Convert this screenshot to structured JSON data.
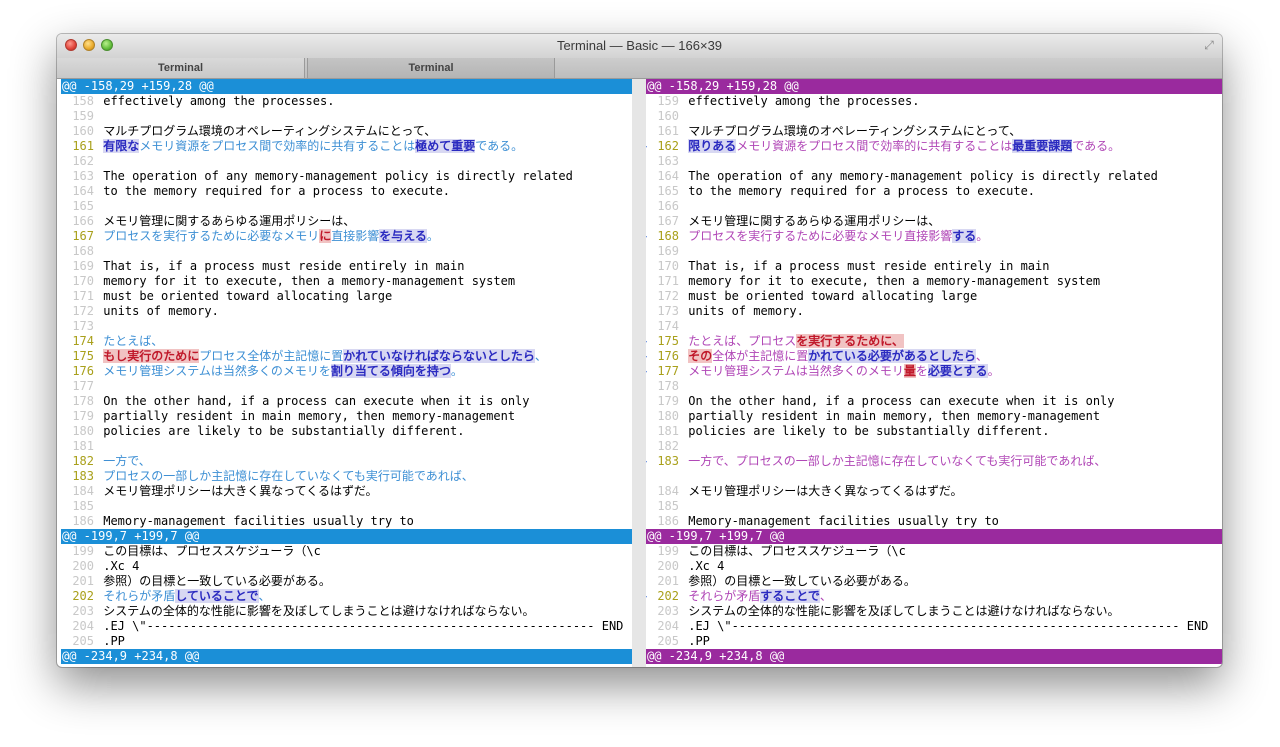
{
  "window": {
    "title": "Terminal — Basic — 166×39",
    "tabs": [
      "Terminal",
      "Terminal"
    ]
  },
  "colors": {
    "left_header": "#1b8fd7",
    "right_header": "#9a2a9e",
    "left_changed": "#3d8fd4",
    "right_changed": "#b046b6"
  },
  "icons": {
    "fullscreen": "⤢",
    "diff_marker": "<>",
    "left_only_marker": "<"
  },
  "left": [
    {
      "t": "h",
      "s": [
        [
          "@@ -158,29 +159,28 @@"
        ]
      ]
    },
    {
      "n": "158",
      "s": [
        [
          "effectively among the processes."
        ]
      ]
    },
    {
      "n": "159",
      "s": []
    },
    {
      "n": "160",
      "s": [
        [
          "マルチプログラム環境のオペレーティングシステムにとって、"
        ]
      ]
    },
    {
      "n": "161",
      "c": true,
      "s": [
        [
          "有限な",
          "h"
        ],
        [
          "メモリ資源をプロセス間で効率的に共有することは"
        ],
        [
          "極めて重要",
          "h"
        ],
        [
          "である。"
        ]
      ]
    },
    {
      "n": "162",
      "s": []
    },
    {
      "n": "163",
      "s": [
        [
          "The operation of any memory-management policy is directly related"
        ]
      ]
    },
    {
      "n": "164",
      "s": [
        [
          "to the memory required for a process to execute."
        ]
      ]
    },
    {
      "n": "165",
      "s": []
    },
    {
      "n": "166",
      "s": [
        [
          "メモリ管理に関するあらゆる運用ポリシーは、"
        ]
      ]
    },
    {
      "n": "167",
      "c": true,
      "s": [
        [
          "プロセスを実行するために必要なメモリ"
        ],
        [
          "に",
          "r"
        ],
        [
          "直接影響"
        ],
        [
          "を与える",
          "h"
        ],
        [
          "。"
        ]
      ]
    },
    {
      "n": "168",
      "s": []
    },
    {
      "n": "169",
      "s": [
        [
          "That is, if a process must reside entirely in main"
        ]
      ]
    },
    {
      "n": "170",
      "s": [
        [
          "memory for it to execute, then a memory-management system"
        ]
      ]
    },
    {
      "n": "171",
      "s": [
        [
          "must be oriented toward allocating large"
        ]
      ]
    },
    {
      "n": "172",
      "s": [
        [
          "units of memory."
        ]
      ]
    },
    {
      "n": "173",
      "s": []
    },
    {
      "n": "174",
      "c": true,
      "s": [
        [
          "たとえば、"
        ]
      ]
    },
    {
      "n": "175",
      "c": true,
      "s": [
        [
          "もし実行のために",
          "r"
        ],
        [
          "プロセス全体が主記憶に置"
        ],
        [
          "かれていなければならないとしたら",
          "h"
        ],
        [
          "、"
        ]
      ]
    },
    {
      "n": "176",
      "c": true,
      "s": [
        [
          "メモリ管理システムは当然多くのメモリを"
        ],
        [
          "割り当てる傾向を持つ",
          "h"
        ],
        [
          "。"
        ]
      ]
    },
    {
      "n": "177",
      "s": []
    },
    {
      "n": "178",
      "s": [
        [
          "On the other hand, if a process can execute when it is only"
        ]
      ]
    },
    {
      "n": "179",
      "s": [
        [
          "partially resident in main memory, then memory-management"
        ]
      ]
    },
    {
      "n": "180",
      "s": [
        [
          "policies are likely to be substantially different."
        ]
      ]
    },
    {
      "n": "181",
      "s": []
    },
    {
      "n": "182",
      "c": true,
      "s": [
        [
          "一方で、"
        ]
      ]
    },
    {
      "n": "183",
      "c": true,
      "s": [
        [
          "プロセスの一部しか主記憶に存在していなくても実行可能であれば、"
        ]
      ]
    },
    {
      "n": "184",
      "s": [
        [
          "メモリ管理ポリシーは大きく異なってくるはずだ。"
        ]
      ]
    },
    {
      "n": "185",
      "s": []
    },
    {
      "n": "186",
      "s": [
        [
          "Memory-management facilities usually try to"
        ]
      ]
    },
    {
      "t": "h",
      "s": [
        [
          "@@ -199,7 +199,7 @@"
        ]
      ]
    },
    {
      "n": "199",
      "s": [
        [
          "この目標は、プロセススケジューラ（\\c"
        ]
      ]
    },
    {
      "n": "200",
      "s": [
        [
          ".Xc 4"
        ]
      ]
    },
    {
      "n": "201",
      "s": [
        [
          "参照）の目標と一致している必要がある。"
        ]
      ]
    },
    {
      "n": "202",
      "c": true,
      "s": [
        [
          "それらが矛盾"
        ],
        [
          "していることで",
          "h"
        ],
        [
          "、"
        ]
      ]
    },
    {
      "n": "203",
      "s": [
        [
          "システムの全体的な性能に影響を及ぼしてしまうことは避けなければならない。"
        ]
      ]
    },
    {
      "n": "204",
      "s": [
        [
          ".EJ \\\"-------------------------------------------------------------- END"
        ]
      ]
    },
    {
      "n": "205",
      "s": [
        [
          ".PP"
        ]
      ]
    },
    {
      "t": "h",
      "s": [
        [
          "@@ -234,9 +234,8 @@"
        ]
      ]
    }
  ],
  "right": [
    {
      "t": "h",
      "s": [
        [
          "@@ -158,29 +159,28 @@"
        ]
      ]
    },
    {
      "n": "159",
      "s": [
        [
          "effectively among the processes."
        ]
      ]
    },
    {
      "n": "160",
      "s": []
    },
    {
      "n": "161",
      "s": [
        [
          "マルチプログラム環境のオペレーティングシステムにとって、"
        ]
      ]
    },
    {
      "n": "162",
      "c": true,
      "m": "<>",
      "s": [
        [
          "限りある",
          "h"
        ],
        [
          "メモリ資源をプロセス間で効率的に共有することは"
        ],
        [
          "最重要課題",
          "h"
        ],
        [
          "である。"
        ]
      ]
    },
    {
      "n": "163",
      "s": []
    },
    {
      "n": "164",
      "s": [
        [
          "The operation of any memory-management policy is directly related"
        ]
      ]
    },
    {
      "n": "165",
      "s": [
        [
          "to the memory required for a process to execute."
        ]
      ]
    },
    {
      "n": "166",
      "s": []
    },
    {
      "n": "167",
      "s": [
        [
          "メモリ管理に関するあらゆる運用ポリシーは、"
        ]
      ]
    },
    {
      "n": "168",
      "c": true,
      "m": "<>",
      "s": [
        [
          "プロセスを実行するために必要なメモリ直接影響"
        ],
        [
          "する",
          "h"
        ],
        [
          "。"
        ]
      ]
    },
    {
      "n": "169",
      "s": []
    },
    {
      "n": "170",
      "s": [
        [
          "That is, if a process must reside entirely in main"
        ]
      ]
    },
    {
      "n": "171",
      "s": [
        [
          "memory for it to execute, then a memory-management system"
        ]
      ]
    },
    {
      "n": "172",
      "s": [
        [
          "must be oriented toward allocating large"
        ]
      ]
    },
    {
      "n": "173",
      "s": [
        [
          "units of memory."
        ]
      ]
    },
    {
      "n": "174",
      "s": []
    },
    {
      "n": "175",
      "c": true,
      "m": "<>",
      "s": [
        [
          "たとえば、プロセス"
        ],
        [
          "を実行するために、",
          "r"
        ]
      ]
    },
    {
      "n": "176",
      "c": true,
      "m": "<>",
      "s": [
        [
          "その",
          "r"
        ],
        [
          "全体が主記憶に置"
        ],
        [
          "かれている必要があるとしたら",
          "h"
        ],
        [
          "、"
        ]
      ]
    },
    {
      "n": "177",
      "c": true,
      "m": "<>",
      "s": [
        [
          "メモリ管理システムは当然多くのメモリ"
        ],
        [
          "量",
          "r"
        ],
        [
          "を"
        ],
        [
          "必要とする",
          "h"
        ],
        [
          "。"
        ]
      ]
    },
    {
      "n": "178",
      "s": []
    },
    {
      "n": "179",
      "s": [
        [
          "On the other hand, if a process can execute when it is only"
        ]
      ]
    },
    {
      "n": "180",
      "s": [
        [
          "partially resident in main memory, then memory-management"
        ]
      ]
    },
    {
      "n": "181",
      "s": [
        [
          "policies are likely to be substantially different."
        ]
      ]
    },
    {
      "n": "182",
      "s": []
    },
    {
      "n": "183",
      "c": true,
      "m": "<>",
      "s": [
        [
          "一方で、プロセスの一部しか主記憶に存在していなくても実行可能であれば、"
        ]
      ]
    },
    {
      "m": "<",
      "s": []
    },
    {
      "n": "184",
      "s": [
        [
          "メモリ管理ポリシーは大きく異なってくるはずだ。"
        ]
      ]
    },
    {
      "n": "185",
      "s": []
    },
    {
      "n": "186",
      "s": [
        [
          "Memory-management facilities usually try to"
        ]
      ]
    },
    {
      "t": "h",
      "s": [
        [
          "@@ -199,7 +199,7 @@"
        ]
      ]
    },
    {
      "n": "199",
      "s": [
        [
          "この目標は、プロセススケジューラ（\\c"
        ]
      ]
    },
    {
      "n": "200",
      "s": [
        [
          ".Xc 4"
        ]
      ]
    },
    {
      "n": "201",
      "s": [
        [
          "参照）の目標と一致している必要がある。"
        ]
      ]
    },
    {
      "n": "202",
      "c": true,
      "m": "<>",
      "s": [
        [
          "それらが矛盾"
        ],
        [
          "することで",
          "h"
        ],
        [
          "、"
        ]
      ]
    },
    {
      "n": "203",
      "s": [
        [
          "システムの全体的な性能に影響を及ぼしてしまうことは避けなければならない。"
        ]
      ]
    },
    {
      "n": "204",
      "s": [
        [
          ".EJ \\\"-------------------------------------------------------------- END"
        ]
      ]
    },
    {
      "n": "205",
      "s": [
        [
          ".PP"
        ]
      ]
    },
    {
      "t": "h",
      "s": [
        [
          "@@ -234,9 +234,8 @@"
        ]
      ]
    }
  ]
}
